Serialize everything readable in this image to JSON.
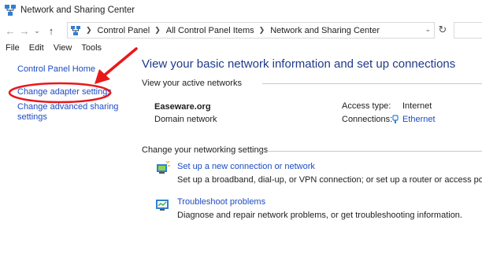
{
  "window": {
    "title": "Network and Sharing Center"
  },
  "address": {
    "crumbs": [
      "Control Panel",
      "All Control Panel Items",
      "Network and Sharing Center"
    ]
  },
  "menu": [
    "File",
    "Edit",
    "View",
    "Tools"
  ],
  "sidebar": {
    "home": "Control Panel Home",
    "adapter": "Change adapter settings",
    "sharing": "Change advanced sharing settings"
  },
  "main": {
    "title": "View your basic network information and set up connections",
    "active_label": "View your active networks",
    "network": {
      "name": "Easeware.org",
      "type": "Domain network",
      "access_key": "Access type:",
      "access_value": "Internet",
      "connections_key": "Connections:",
      "connections_value": "Ethernet"
    },
    "change_label": "Change your networking settings",
    "tasks": [
      {
        "link": "Set up a new connection or network",
        "desc": "Set up a broadband, dial-up, or VPN connection; or set up a router or access point."
      },
      {
        "link": "Troubleshoot problems",
        "desc": "Diagnose and repair network problems, or get troubleshooting information."
      }
    ]
  },
  "annotation": {
    "color": "#e8181b"
  }
}
